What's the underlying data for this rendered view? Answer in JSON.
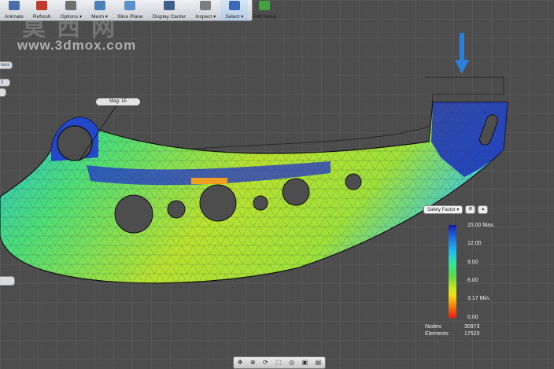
{
  "toolbar": {
    "items": [
      {
        "label": "Animate",
        "icon": "animate-icon",
        "color": "#4b6fa8"
      },
      {
        "label": "Refresh",
        "icon": "refresh-icon",
        "color": "#c0392b"
      },
      {
        "label": "Options ▾",
        "icon": "options-icon",
        "color": "#6f6f6f"
      },
      {
        "label": "Mesh ▾",
        "icon": "mesh-icon",
        "color": "#4a7fb8"
      },
      {
        "label": "Slice Plane",
        "icon": "slice-plane-icon",
        "color": "#5b8fc9"
      },
      {
        "label": "Display Center",
        "icon": "display-center-icon",
        "color": "#3e5f8a"
      },
      {
        "label": "Inspect ▾",
        "icon": "inspect-icon",
        "color": "#7d7d7d"
      },
      {
        "label": "Select ▾",
        "icon": "select-icon",
        "color": "#3a6ab8"
      },
      {
        "label": "Edit Setup",
        "icon": "checkmark-icon",
        "color": "#3fa33f"
      }
    ]
  },
  "watermark": {
    "text_cn": "莫西网",
    "url": "www.3dmox.com"
  },
  "side_tabs": [
    "ress",
    "2"
  ],
  "probe_label": "Mag: 15",
  "legend": {
    "result": "Safety Factor ▾",
    "ticks": [
      "15.00 Max.",
      "12.00",
      "9.00",
      "6.00",
      "3.17 Min.",
      "0.00"
    ],
    "nodes_label": "Nodes:",
    "nodes_value": "30973",
    "elements_label": "Elements:",
    "elements_value": "17520"
  },
  "colors": {
    "max": "#1a1aa0",
    "min": "#e21e12",
    "load_arrow": "#2b7fd8"
  }
}
